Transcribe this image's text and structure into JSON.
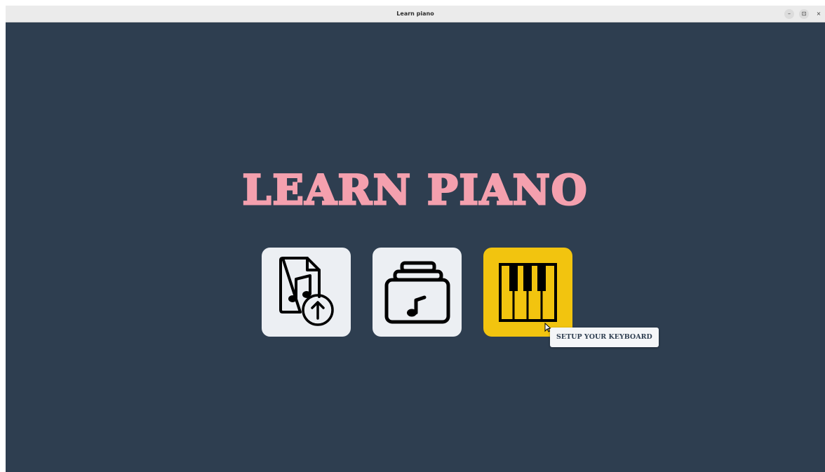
{
  "window": {
    "title": "Learn piano",
    "controls": {
      "minimize": "–",
      "maximize": "⊡",
      "close": "×"
    }
  },
  "app": {
    "title": "LEARN PIANO"
  },
  "tiles": [
    {
      "id": "upload-song",
      "icon": "music-file-upload-icon",
      "active": false
    },
    {
      "id": "song-library",
      "icon": "music-folder-icon",
      "active": false
    },
    {
      "id": "setup-keyboard",
      "icon": "piano-keys-icon",
      "active": true
    }
  ],
  "tooltip": {
    "text": "SETUP YOUR KEYBOARD"
  },
  "colors": {
    "background": "#2e3e50",
    "title": "#f4a0ae",
    "tile": "#eceff3",
    "tile_active": "#f2c40f",
    "tooltip_text": "#2e3e50"
  }
}
